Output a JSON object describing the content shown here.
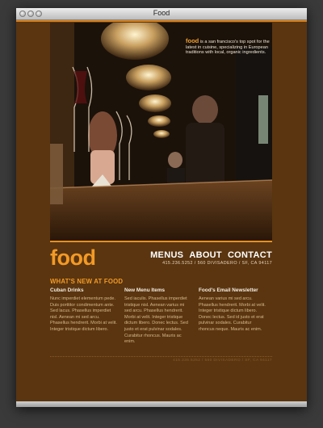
{
  "window": {
    "title": "Food"
  },
  "hero": {
    "brand": "food",
    "tagline": " is a san francisco's top spot for the latest in cuisine, specializing in European traditions with local, organic ingredients."
  },
  "header": {
    "logo": "food",
    "nav": [
      "MENUS",
      "ABOUT",
      "CONTACT"
    ],
    "address": "415.236.5252 / 560 DIVISADERO / SF, CA 94117"
  },
  "main": {
    "section_title": "WHAT'S NEW AT FOOD",
    "columns": [
      {
        "title": "Cuban Drinks",
        "body": "Nunc imperdiet elementum pede. Duis porttitor condimentum ante. Sed lacus. Phasellus imperdiet nisl. Aenean mi sed arcu. Phasellus hendrerit. Morbi at velit. Integer tristique dictum libero."
      },
      {
        "title": "New Menu Items",
        "body": "Sed iaculis. Phasellus imperdiet tristique nisl. Aenean varius mi sed arcu. Phasellus hendrerit. Morbi at velit. Integer tristique dictum libero. Donec lectus. Sed justo et erat pulvinar sodales. Curabitur rhoncus. Mauris ac enim."
      },
      {
        "title": "Food's Email Newsletter",
        "body": "Aenean varius mi sed arcu. Phasellus hendrerit. Morbi at velit. Integer tristique dictum libero. Donec lectus. Sed id justo et erat pulvinar sodales. Curabitur rhoncus neque. Mauris ac enim."
      }
    ]
  },
  "footer": {
    "text": "415.236.5252 / 560 DIVISADERO / SF, CA 94117"
  },
  "colors": {
    "accent": "#f39a25",
    "background": "#5a3510"
  }
}
